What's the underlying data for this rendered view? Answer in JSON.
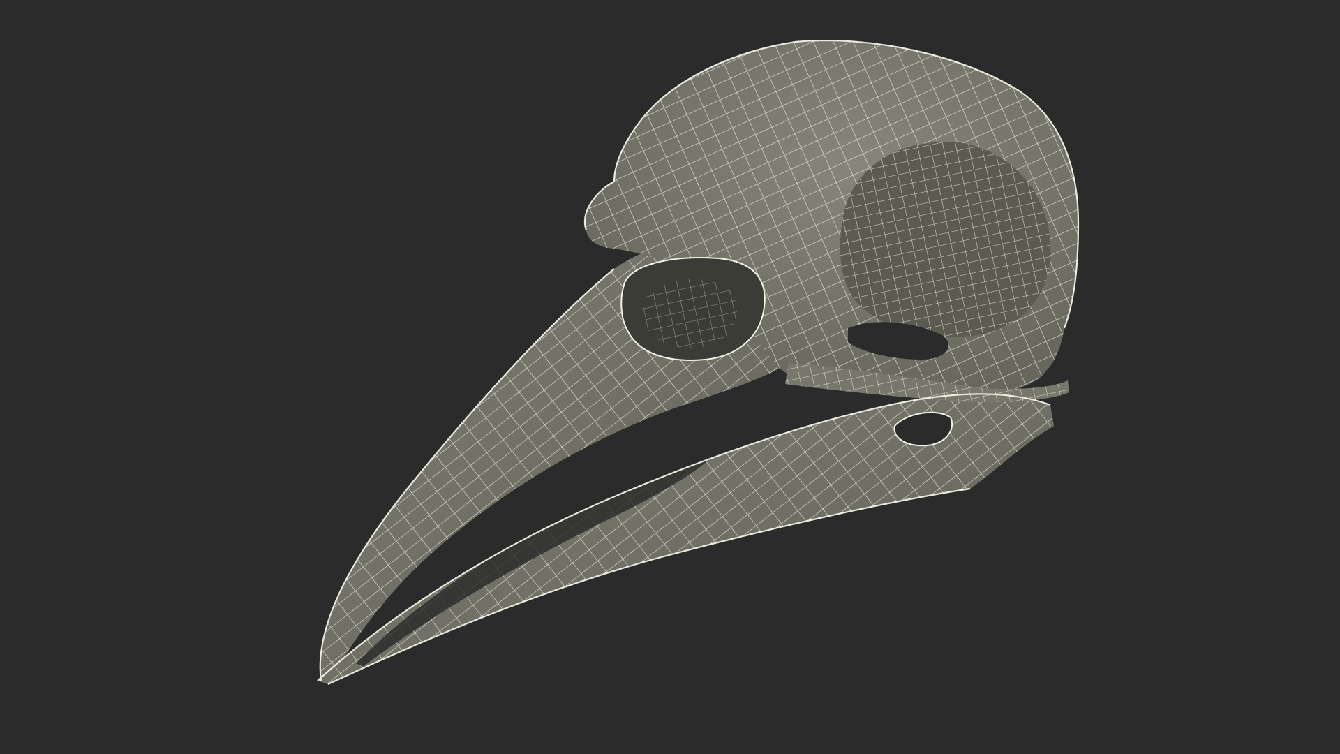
{
  "scene": {
    "subject": "bird-skull-wireframe",
    "colors": {
      "background": "#2b2b2b",
      "surface": "#77776c",
      "surface_dark": "#5e5e55",
      "cavity": "#3c3c37",
      "wire": "#f2f2e6"
    }
  }
}
